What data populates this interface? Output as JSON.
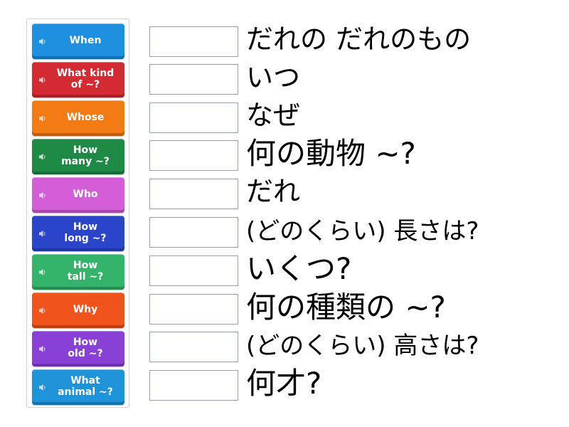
{
  "tiles": [
    {
      "label": "When",
      "color": "#1f8fe0"
    },
    {
      "label": "What kind\nof ~?",
      "color": "#d42a33"
    },
    {
      "label": "Whose",
      "color": "#f47a14"
    },
    {
      "label": "How\nmany ~?",
      "color": "#1f8a46"
    },
    {
      "label": "Who",
      "color": "#d35ed8"
    },
    {
      "label": "How\nlong ~?",
      "color": "#2a45c9"
    },
    {
      "label": "How\ntall ~?",
      "color": "#34b36a"
    },
    {
      "label": "Why",
      "color": "#f0541c"
    },
    {
      "label": "How\nold ~?",
      "color": "#8a3fd6"
    },
    {
      "label": "What\nanimal ~?",
      "color": "#1f93d8"
    }
  ],
  "answers": [
    "だれの だれのもの",
    "いつ",
    "なぜ",
    "何の動物 ~?",
    "だれ",
    "(どのくらい) 長さは?",
    "いくつ?",
    "何の種類の ~?",
    "(どのくらい) 高さは?",
    "何才?"
  ],
  "icons": {
    "tile_icon": "speaker-icon"
  }
}
